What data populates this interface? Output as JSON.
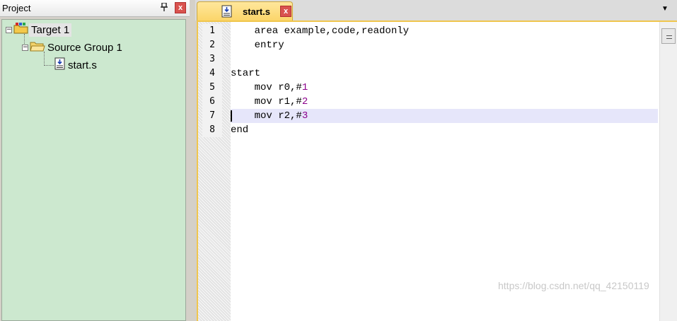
{
  "project_panel": {
    "title": "Project",
    "pin_glyph": "⮝",
    "close_glyph": "x",
    "tree": {
      "target": {
        "label": "Target 1",
        "expander": "−"
      },
      "group": {
        "label": "Source Group 1",
        "expander": "−"
      },
      "file": {
        "label": "start.s"
      }
    }
  },
  "editor": {
    "tab": {
      "label": "start.s",
      "close_glyph": "x"
    },
    "dropdown_glyph": "▼",
    "current_line": 7,
    "lines": [
      {
        "n": "1",
        "text": "    area example,code,readonly"
      },
      {
        "n": "2",
        "text": "    entry"
      },
      {
        "n": "3",
        "text": ""
      },
      {
        "n": "4",
        "text": "start"
      },
      {
        "n": "5",
        "text": "    mov r0,#",
        "num": "1"
      },
      {
        "n": "6",
        "text": "    mov r1,#",
        "num": "2"
      },
      {
        "n": "7",
        "text": "    mov r2,#",
        "num": "3"
      },
      {
        "n": "8",
        "text": "end"
      }
    ]
  },
  "watermark": "https://blog.csdn.net/qq_42150119",
  "colors": {
    "tree_bg": "#cce8cf",
    "tab_bg": "#fbd56a",
    "current_line": "#e6e6fa",
    "number_literal": "#8b008b"
  }
}
